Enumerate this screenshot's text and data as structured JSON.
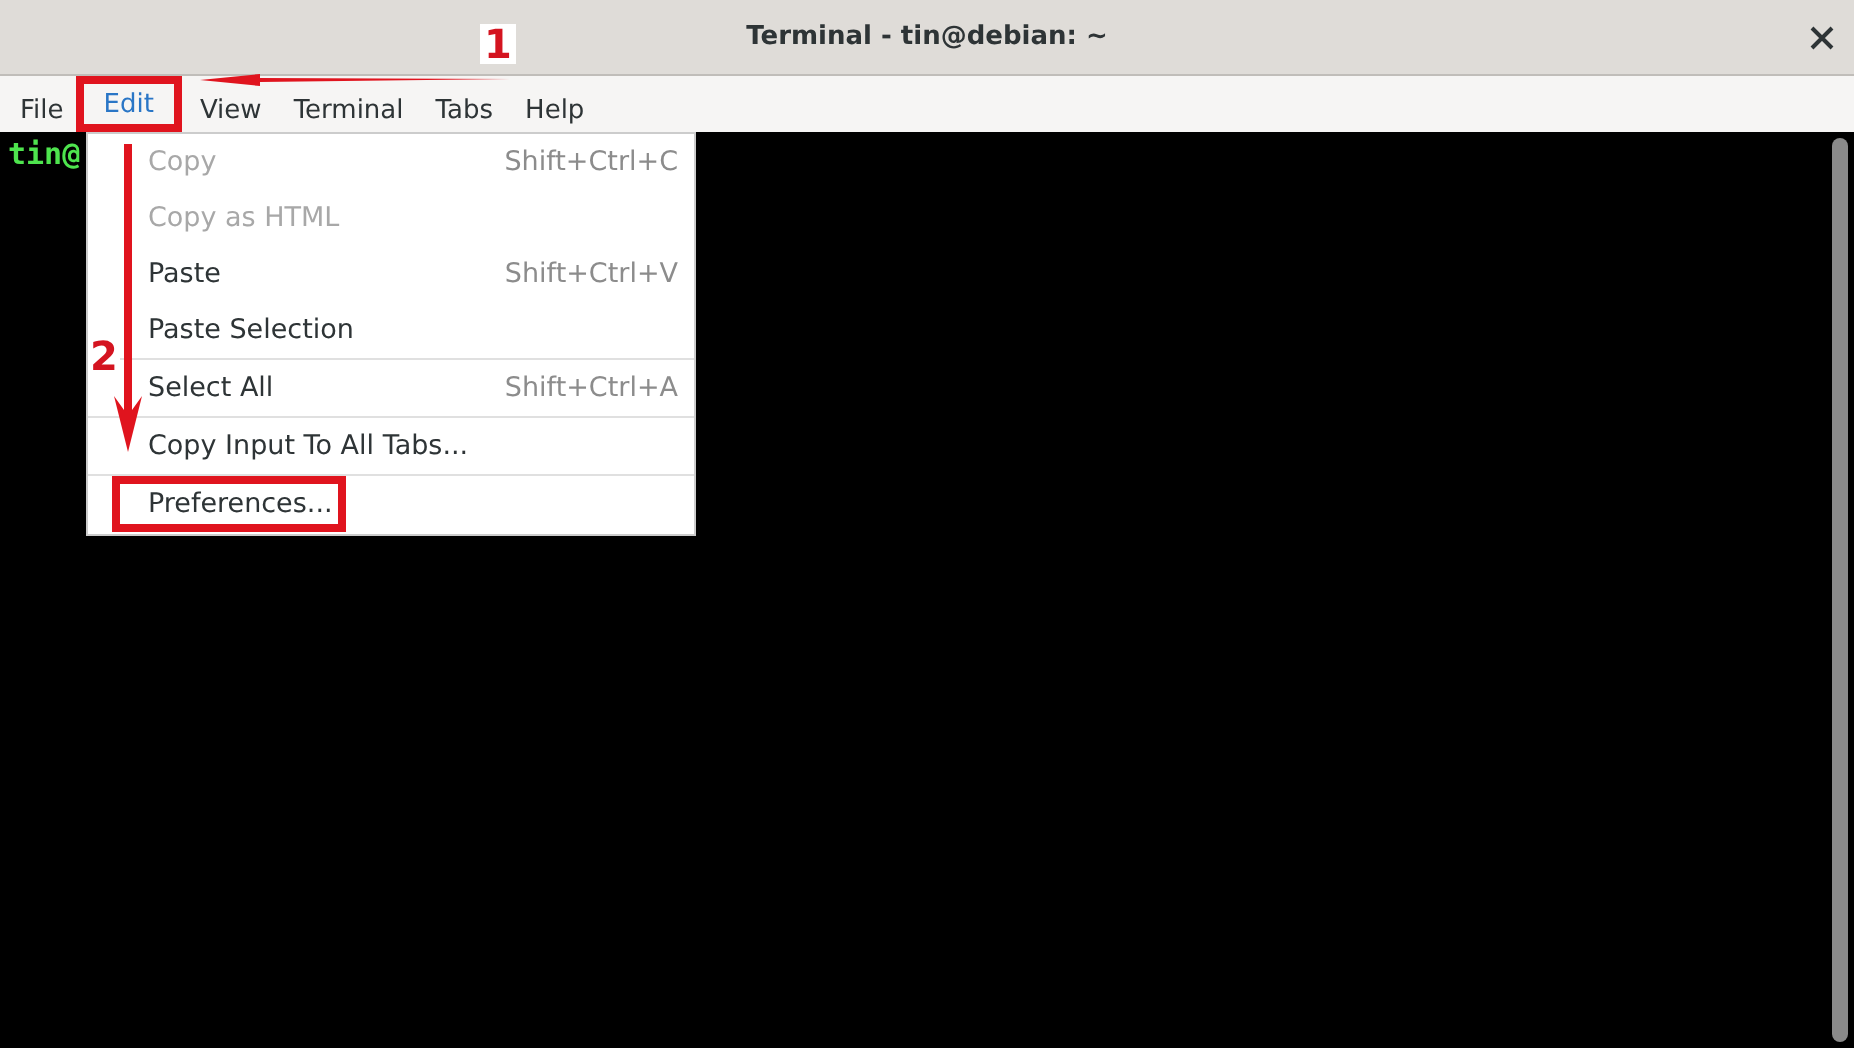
{
  "window": {
    "title": "Terminal - tin@debian: ~"
  },
  "menubar": [
    {
      "label": "File",
      "selected": false,
      "highlighted": false
    },
    {
      "label": "Edit",
      "selected": true,
      "highlighted": true
    },
    {
      "label": "View",
      "selected": false,
      "highlighted": false
    },
    {
      "label": "Terminal",
      "selected": false,
      "highlighted": false
    },
    {
      "label": "Tabs",
      "selected": false,
      "highlighted": false
    },
    {
      "label": "Help",
      "selected": false,
      "highlighted": false
    }
  ],
  "terminal": {
    "prompt": "tin@"
  },
  "menu": {
    "sections": [
      [
        {
          "label": "Copy",
          "shortcut": "Shift+Ctrl+C",
          "disabled": true,
          "highlighted": false
        },
        {
          "label": "Copy as HTML",
          "disabled": true,
          "highlighted": false
        },
        {
          "label": "Paste",
          "shortcut": "Shift+Ctrl+V",
          "disabled": false,
          "highlighted": false
        },
        {
          "label": "Paste Selection",
          "disabled": false,
          "highlighted": false
        }
      ],
      [
        {
          "label": "Select All",
          "shortcut": "Shift+Ctrl+A",
          "disabled": false,
          "highlighted": false
        }
      ],
      [
        {
          "label": "Copy Input To All Tabs...",
          "disabled": false,
          "highlighted": false
        }
      ],
      [
        {
          "label": "Preferences...",
          "disabled": false,
          "highlighted": true
        }
      ]
    ]
  },
  "annotations": {
    "markers": [
      {
        "label": "1"
      },
      {
        "label": "2"
      }
    ]
  }
}
